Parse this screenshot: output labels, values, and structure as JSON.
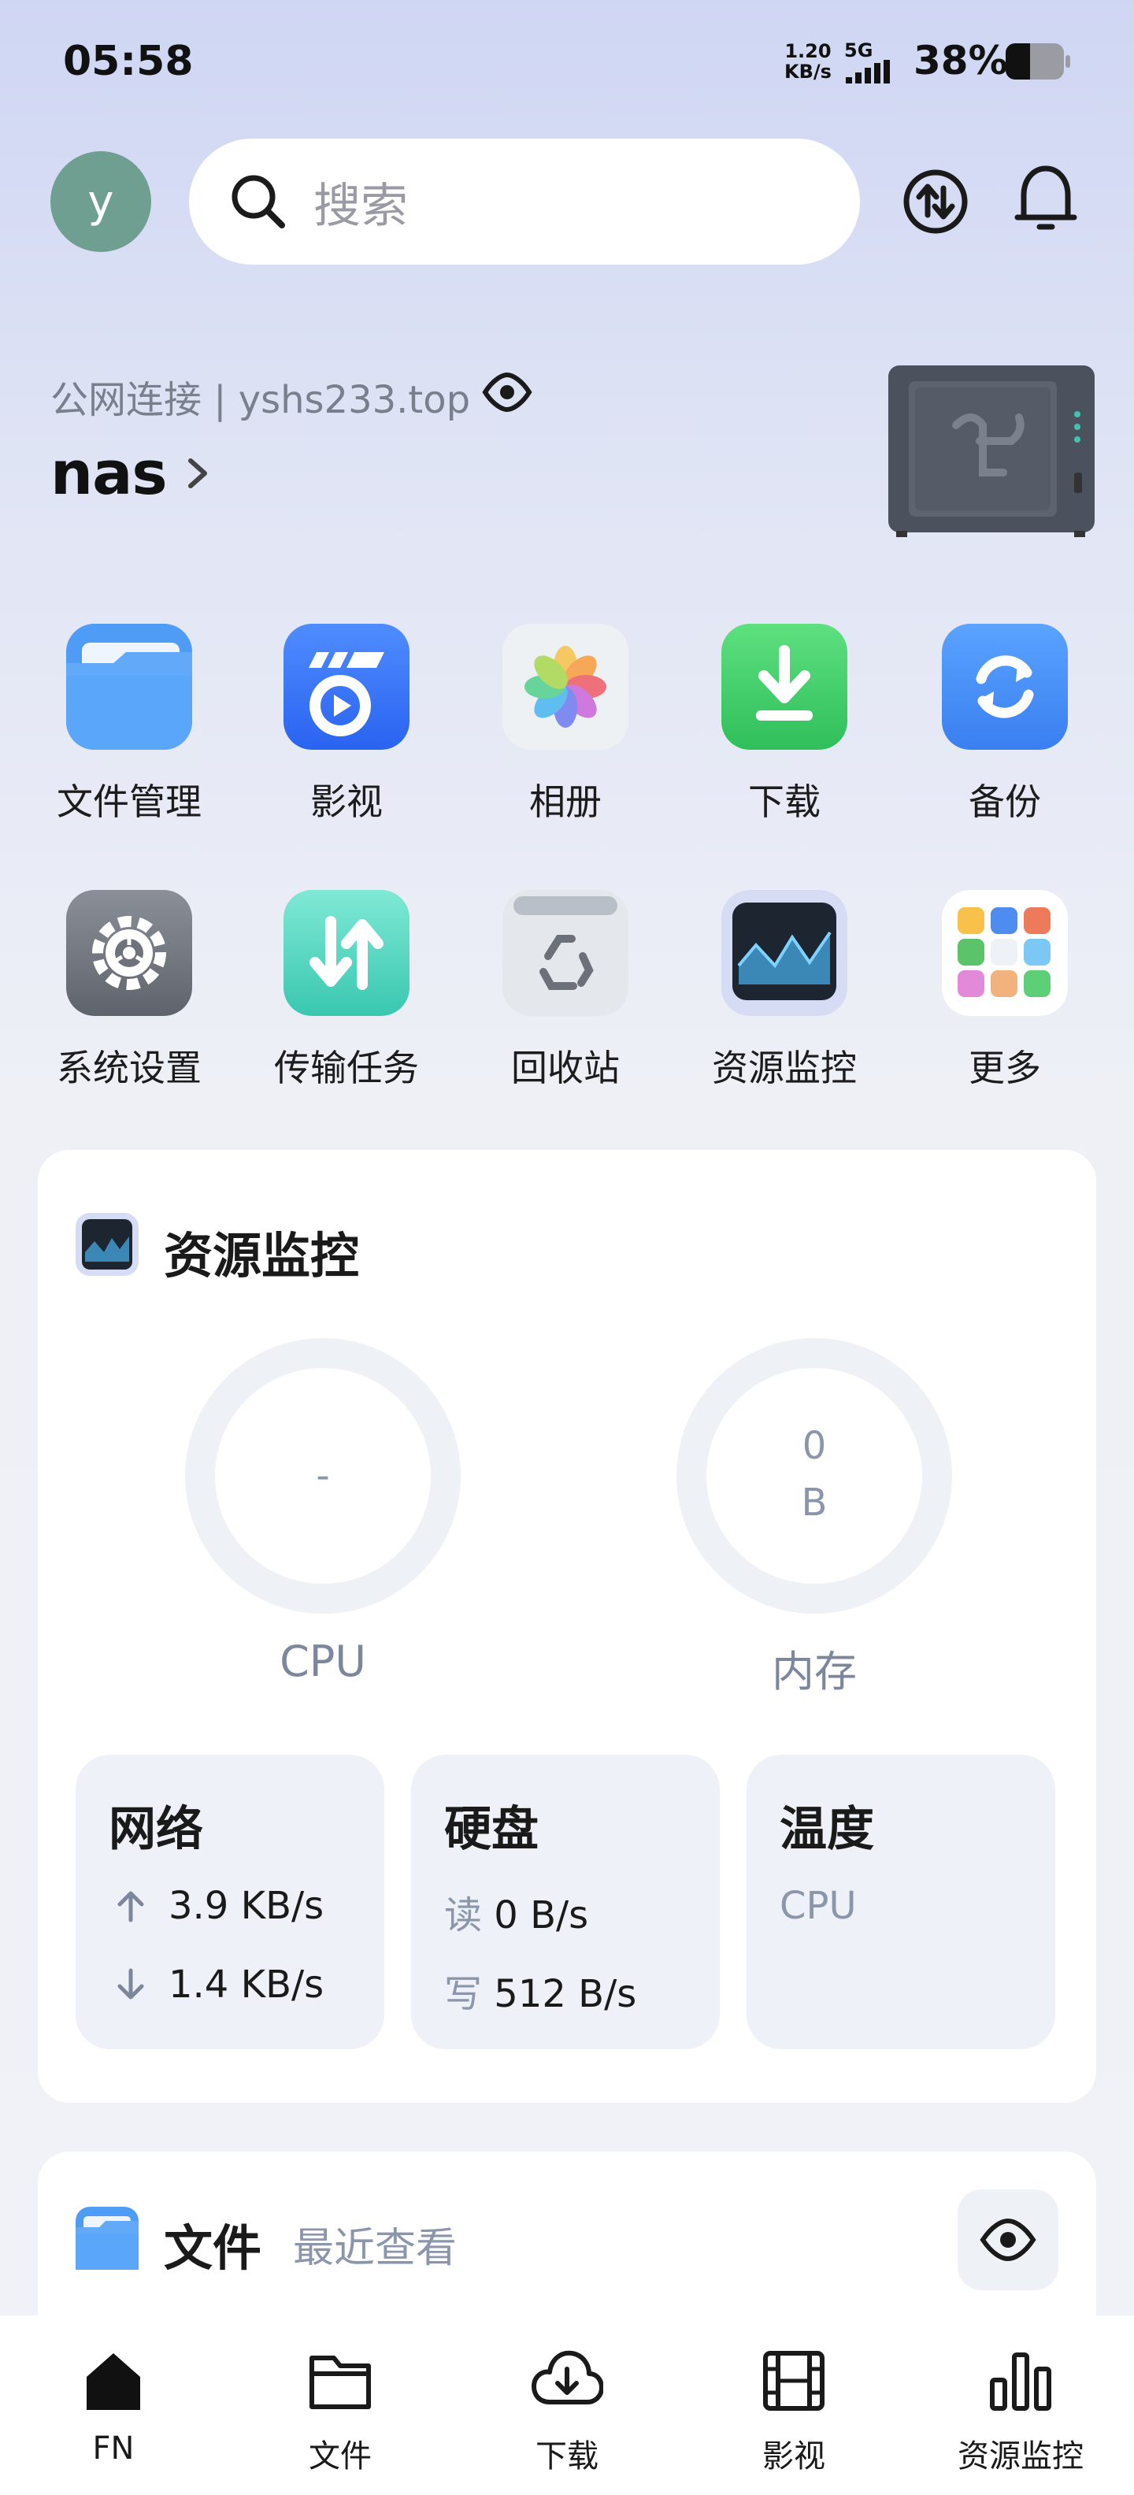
{
  "status_bar": {
    "time": "05:58",
    "net_speed_value": "1.20",
    "net_speed_unit": "KB/s",
    "network_type": "5G",
    "battery": "38%"
  },
  "header": {
    "avatar_letter": "y",
    "search_placeholder": "搜索"
  },
  "device": {
    "connection": "公网连接 | yshs233.top",
    "name": "nas"
  },
  "apps": [
    {
      "label": "文件管理"
    },
    {
      "label": "影视"
    },
    {
      "label": "相册"
    },
    {
      "label": "下载"
    },
    {
      "label": "备份"
    },
    {
      "label": "系统设置"
    },
    {
      "label": "传输任务"
    },
    {
      "label": "回收站"
    },
    {
      "label": "资源监控"
    },
    {
      "label": "更多"
    }
  ],
  "monitor": {
    "title": "资源监控",
    "cpu_value": "-",
    "cpu_label": "CPU",
    "mem_value": "0",
    "mem_unit": "B",
    "mem_label": "内存",
    "network": {
      "title": "网络",
      "up": "3.9 KB/s",
      "down": "1.4 KB/s"
    },
    "disk": {
      "title": "硬盘",
      "read_key": "读",
      "read": "0 B/s",
      "write_key": "写",
      "write": "512 B/s"
    },
    "temp": {
      "title": "温度",
      "cpu": "CPU"
    }
  },
  "files": {
    "title": "文件",
    "subtitle": "最近查看"
  },
  "nav": [
    {
      "label": "FN"
    },
    {
      "label": "文件"
    },
    {
      "label": "下载"
    },
    {
      "label": "影视"
    },
    {
      "label": "资源监控"
    }
  ]
}
